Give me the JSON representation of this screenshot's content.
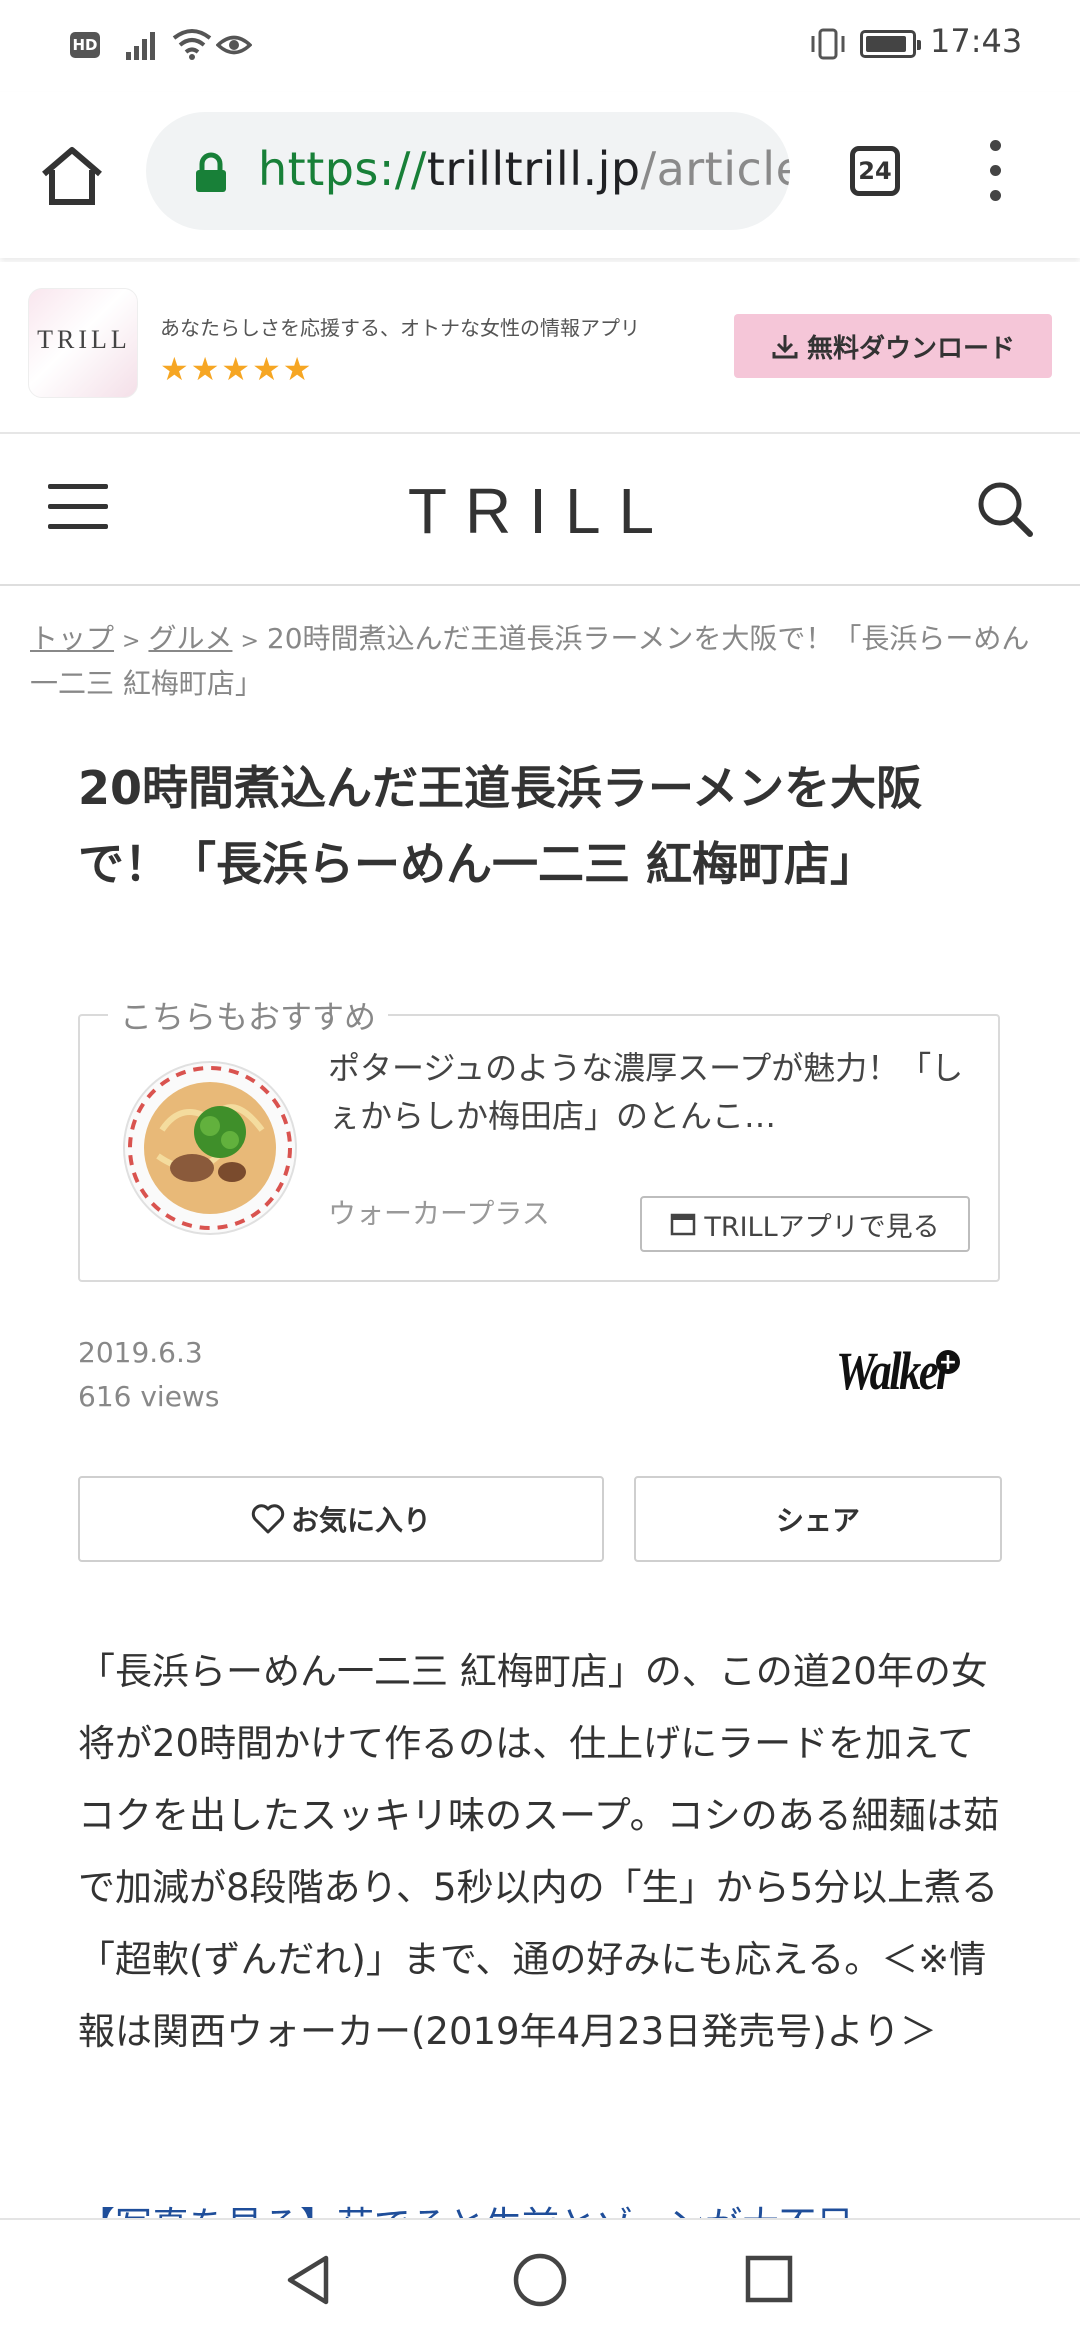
{
  "status_bar": {
    "hd": "HD",
    "time": "17:43"
  },
  "browser": {
    "url_scheme": "https://",
    "url_host": "trilltrill.jp",
    "url_path": "/articles",
    "tab_count": "24"
  },
  "app_banner": {
    "icon_text": "TRILL",
    "tagline": "あなたらしさを応援する、オトナな女性の情報アプリ",
    "rating_stars": "★★★★★",
    "rating": 4.5,
    "download_label": "無料ダウンロード"
  },
  "site_header": {
    "logo": "TRILL"
  },
  "breadcrumb": {
    "top": "トップ",
    "category": "グルメ",
    "separator": ">",
    "current": "20時間煮込んだ王道長浜ラーメンを大阪で！「長浜らーめん一二三 紅梅町店」"
  },
  "article": {
    "title": "20時間煮込んだ王道長浜ラーメンを大阪で！「長浜らーめん一二三 紅梅町店」",
    "date": "2019.6.3",
    "views": "616 views",
    "publisher_logo": "Walker",
    "favorite_label": "お気に入り",
    "share_label": "シェア",
    "body": "「長浜らーめん一二三 紅梅町店」の、この道20年の女将が20時間かけて作るのは、仕上げにラードを加えてコクを出したスッキリ味のスープ。コシのある細麺は茹で加減が8段階あり、5秒以内の「生」から5分以上煮る「超軟(ずんだれ)」まで、通の好みにも応える。＜※情報は関西ウォーカー(2019年4月23日発売号)より＞",
    "next_link": "【写真を見る】茹でると生前とゾーンが大不足"
  },
  "recommend": {
    "label": "こちらもおすすめ",
    "title": "ポタージュのような濃厚スープが魅力！「しぇからしか梅田店」のとんこ…",
    "source": "ウォーカープラス",
    "app_button_label": "TRILLアプリで見る"
  },
  "colors": {
    "url_scheme": "#188038",
    "download_bg": "#f5c6d8",
    "stars": "#f6a623",
    "link": "#1f4e9a"
  }
}
